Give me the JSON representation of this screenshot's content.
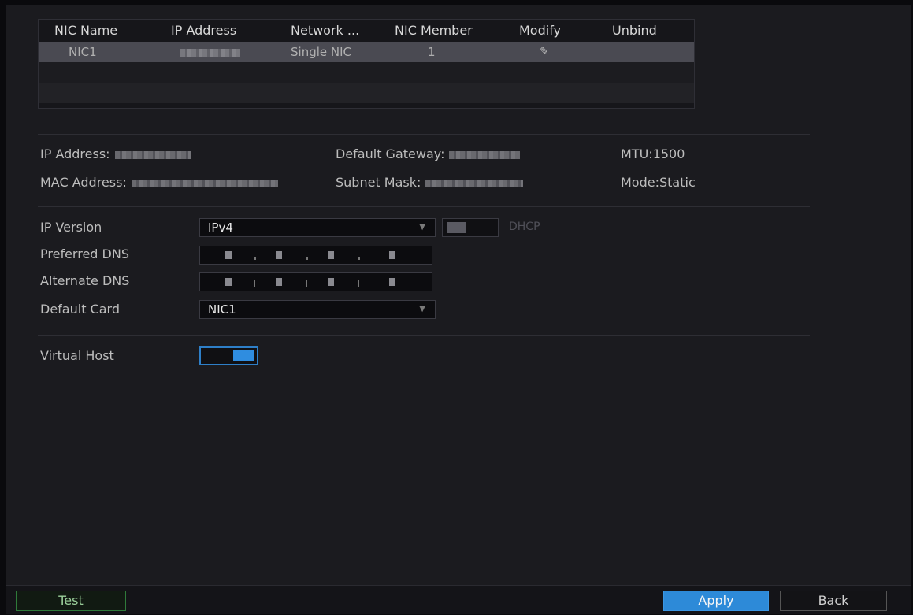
{
  "nic_table": {
    "headers": [
      "NIC Name",
      "IP Address",
      "Network ...",
      "NIC Member",
      "Modify",
      "Unbind"
    ],
    "row": {
      "nic_name": "NIC1",
      "network_mode": "Single NIC",
      "nic_member": "1",
      "modify_icon": "pencil-icon"
    }
  },
  "info": {
    "ip_address_label": "IP Address:",
    "mac_address_label": "MAC Address:",
    "default_gateway_label": "Default Gateway:",
    "subnet_mask_label": "Subnet Mask:",
    "mtu_label": "MTU:",
    "mtu_value": "1500",
    "mode_label": "Mode:",
    "mode_value": "Static"
  },
  "form": {
    "ip_version_label": "IP Version",
    "ip_version_value": "IPv4",
    "dhcp_label": "DHCP",
    "dhcp_enabled": false,
    "preferred_dns_label": "Preferred DNS",
    "alternate_dns_label": "Alternate DNS",
    "default_card_label": "Default Card",
    "default_card_value": "NIC1",
    "virtual_host_label": "Virtual Host",
    "virtual_host_enabled": true
  },
  "buttons": {
    "test": "Test",
    "apply": "Apply",
    "back": "Back"
  },
  "colors": {
    "accent": "#2d8ad8",
    "test_border": "#2f7a3a",
    "selected_row": "#4a4a52"
  }
}
